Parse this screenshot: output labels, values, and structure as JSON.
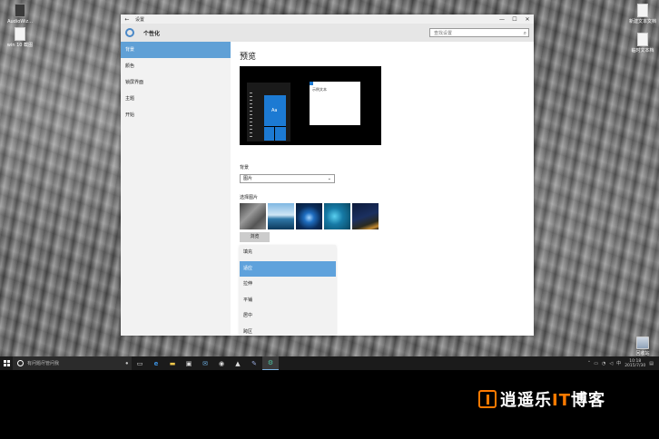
{
  "desktop": {
    "icons_left": [
      {
        "label": "AudioWiz...",
        "icon": "app-icon"
      },
      {
        "label": "win 10 截图",
        "icon": "document-icon"
      }
    ],
    "icons_right": [
      {
        "label": "新建文本文档",
        "icon": "document-icon"
      },
      {
        "label": "临时文本档",
        "icon": "document-icon"
      }
    ],
    "recycle_bin_label": "回收站"
  },
  "window": {
    "title": "设置",
    "back_glyph": "←",
    "controls": {
      "minimize": "—",
      "maximize": "☐",
      "close": "✕"
    },
    "header_title": "个性化",
    "search_placeholder": "查找设置",
    "nav": [
      "背景",
      "颜色",
      "锁屏界面",
      "主题",
      "开始"
    ],
    "active_nav_index": 0,
    "section_title": "预览",
    "preview": {
      "tile_text": "Aa",
      "window_text": "示例文本"
    },
    "background_label": "背景",
    "background_value": "图片",
    "choose_picture_label": "选择图片",
    "browse_label": "浏览",
    "fit_options": [
      "填充",
      "适应",
      "拉伸",
      "平铺",
      "居中",
      "跨区"
    ],
    "selected_fit_index": 1
  },
  "taskbar": {
    "search_placeholder": "有问题尽管问我",
    "time": "10:18",
    "date": "2015/7/30"
  },
  "watermark": {
    "prefix": "逍遥乐",
    "highlight": "IT",
    "suffix": "博客"
  },
  "colors": {
    "accent": "#60a0d6",
    "selected": "#5fa2dc",
    "watermark_orange": "#ff7a00"
  }
}
